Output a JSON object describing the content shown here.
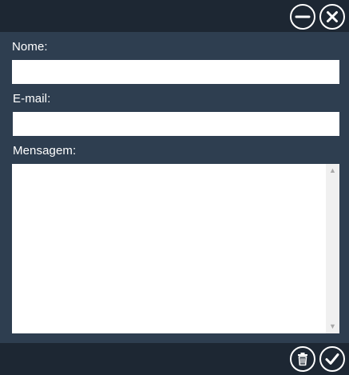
{
  "titlebar": {
    "minimize_icon": "minimize-circle-icon",
    "close_icon": "close-circle-icon"
  },
  "form": {
    "name_label": "Nome:",
    "name_value": "",
    "email_label": "E-mail:",
    "email_value": "",
    "message_label": "Mensagem:",
    "message_value": ""
  },
  "footer": {
    "delete_icon": "trash-icon",
    "confirm_icon": "checkmark-icon"
  },
  "colors": {
    "background": "#2e3e50",
    "bars": "#1d2733",
    "foreground": "#ffffff"
  }
}
